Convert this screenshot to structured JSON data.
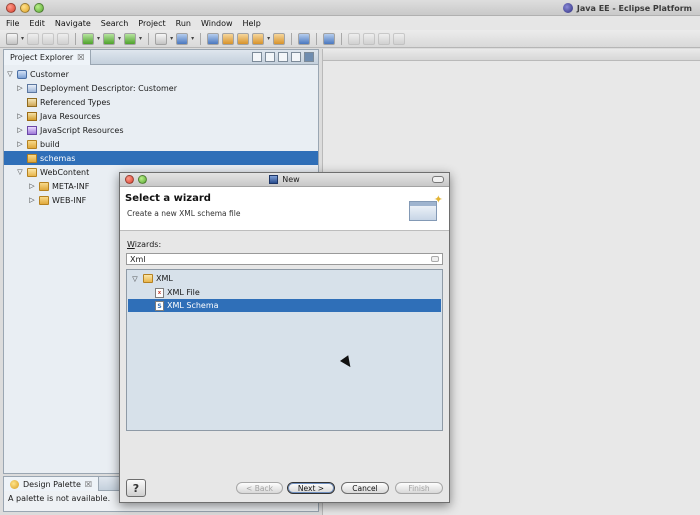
{
  "window": {
    "title": "Java EE - Eclipse Platform"
  },
  "menu": [
    "File",
    "Edit",
    "Navigate",
    "Search",
    "Project",
    "Run",
    "Window",
    "Help"
  ],
  "explorer": {
    "tab_label": "Project Explorer",
    "tab_close": "☒",
    "tree": [
      {
        "label": "Customer",
        "twisty": "▽",
        "icon": "project-icon",
        "indent": 0,
        "selected": false
      },
      {
        "label": "Deployment Descriptor: Customer",
        "twisty": "▷",
        "icon": "descriptor-icon",
        "indent": 1,
        "selected": false
      },
      {
        "label": "Referenced Types",
        "twisty": "",
        "icon": "folder-icon",
        "indent": 1,
        "selected": false
      },
      {
        "label": "Java Resources",
        "twisty": "▷",
        "icon": "java-resources-icon",
        "indent": 1,
        "selected": false
      },
      {
        "label": "JavaScript Resources",
        "twisty": "▷",
        "icon": "javascript-resources-icon",
        "indent": 1,
        "selected": false
      },
      {
        "label": "build",
        "twisty": "▷",
        "icon": "folder-icon",
        "indent": 1,
        "selected": false
      },
      {
        "label": "schemas",
        "twisty": "",
        "icon": "folder-icon",
        "indent": 1,
        "selected": true
      },
      {
        "label": "WebContent",
        "twisty": "▽",
        "icon": "folder-open-icon",
        "indent": 1,
        "selected": false
      },
      {
        "label": "META-INF",
        "twisty": "▷",
        "icon": "folder-icon",
        "indent": 2,
        "selected": false
      },
      {
        "label": "WEB-INF",
        "twisty": "▷",
        "icon": "folder-icon",
        "indent": 2,
        "selected": false
      }
    ]
  },
  "palette": {
    "tab_label": "Design Palette",
    "tab_close": "☒",
    "message": "A palette is not available."
  },
  "dialog": {
    "title": "New",
    "banner_title": "Select a wizard",
    "banner_description": "Create a new XML schema file",
    "wizards_label_prefix": "W",
    "wizards_label_rest": "izards:",
    "filter_value": "Xml",
    "tree": [
      {
        "label": "XML",
        "twisty": "▽",
        "icon": "folder-open-icon",
        "indent": 0,
        "selected": false
      },
      {
        "label": "XML File",
        "twisty": "",
        "icon": "xml-file-icon",
        "indent": 1,
        "selected": false
      },
      {
        "label": "XML Schema",
        "twisty": "",
        "icon": "xml-schema-icon",
        "indent": 1,
        "selected": true
      }
    ],
    "help_label": "?",
    "buttons": {
      "back": "< Back",
      "next": "Next >",
      "cancel": "Cancel",
      "finish": "Finish"
    }
  },
  "colors": {
    "selection": "#2f6fb8",
    "panel_background": "#e9eef3",
    "wizard_tree_background": "#d7e1ea"
  }
}
